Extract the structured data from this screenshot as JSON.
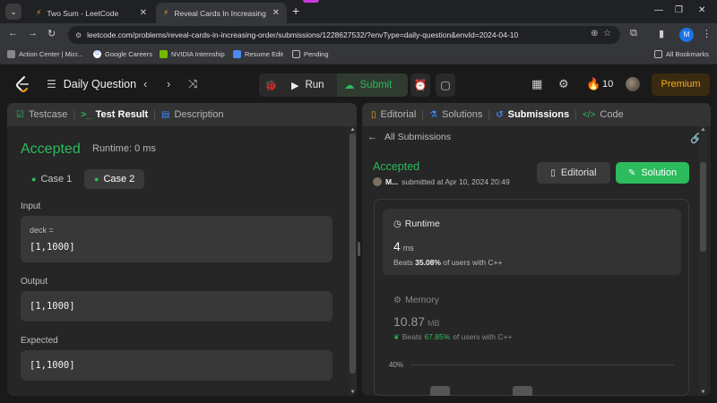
{
  "browser": {
    "tabs": [
      {
        "title": "Two Sum - LeetCode",
        "active": false
      },
      {
        "title": "Reveal Cards In Increasing Orde",
        "active": true
      }
    ],
    "url": "leetcode.com/problems/reveal-cards-in-increasing-order/submissions/1228627532/?envType=daily-question&envId=2024-04-10",
    "profile_letter": "M",
    "bookmarks": [
      "Action Center | Micr...",
      "Google Careers",
      "NVIDIA Internship",
      "Resume Edit",
      "Pending"
    ],
    "all_bookmarks": "All Bookmarks"
  },
  "header": {
    "title": "Daily Question",
    "run": "Run",
    "submit": "Submit",
    "streak": "10",
    "premium": "Premium"
  },
  "left_panel": {
    "tabs": [
      "Testcase",
      "Test Result",
      "Description"
    ],
    "status": "Accepted",
    "runtime": "Runtime: 0 ms",
    "cases": [
      "Case 1",
      "Case 2"
    ],
    "input_label": "Input",
    "input_var": "deck =",
    "input_value": "[1,1000]",
    "output_label": "Output",
    "output_value": "[1,1000]",
    "expected_label": "Expected",
    "expected_value": "[1,1000]"
  },
  "right_panel": {
    "tabs": [
      "Editorial",
      "Solutions",
      "Submissions",
      "Code"
    ],
    "back_label": "All Submissions",
    "status": "Accepted",
    "submitter": "M...",
    "submitted_at": "submitted at Apr 10, 2024 20:49",
    "editorial_btn": "Editorial",
    "solution_btn": "Solution",
    "runtime_title": "Runtime",
    "runtime_value": "4",
    "runtime_unit": "ms",
    "runtime_beats_prefix": "Beats",
    "runtime_beats_pct": "35.08%",
    "runtime_beats_suffix": "of users with C++",
    "memory_title": "Memory",
    "memory_value": "10.87",
    "memory_unit": "MB",
    "memory_beats_prefix": "Beats",
    "memory_beats_pct": "67.85%",
    "memory_beats_suffix": "of users with C++",
    "chart_label": "40%"
  },
  "colors": {
    "accepted": "#2cbb5d",
    "premium": "#f9ae1b",
    "streak_flame": "#f96c1b"
  }
}
